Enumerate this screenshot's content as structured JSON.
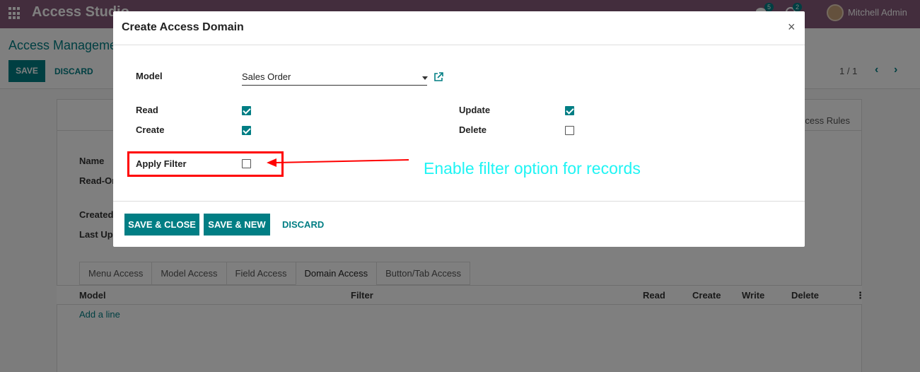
{
  "topbar": {
    "app_title": "Access Studio",
    "chat_count": "5",
    "activity_count": "2",
    "user_name": "Mitchell Admin"
  },
  "control": {
    "breadcrumb": "Access Manageme",
    "save_label": "SAVE",
    "discard_label": "DISCARD",
    "pager": "1 / 1"
  },
  "sheet": {
    "access_rules": "cess Rules",
    "labels": {
      "name": "Name",
      "read_only": "Read-On",
      "created": "Created",
      "last_updated": "Last Upd"
    },
    "tabs": [
      {
        "label": "Menu Access",
        "active": false
      },
      {
        "label": "Model Access",
        "active": false
      },
      {
        "label": "Field Access",
        "active": false
      },
      {
        "label": "Domain Access",
        "active": true
      },
      {
        "label": "Button/Tab Access",
        "active": false
      }
    ],
    "columns": [
      "Model",
      "Filter",
      "Read",
      "Create",
      "Write",
      "Delete"
    ],
    "add_line": "Add a line"
  },
  "modal": {
    "title": "Create Access Domain",
    "close": "×",
    "fields": {
      "model_label": "Model",
      "model_value": "Sales Order",
      "read_label": "Read",
      "read_checked": true,
      "create_label": "Create",
      "create_checked": true,
      "update_label": "Update",
      "update_checked": true,
      "delete_label": "Delete",
      "delete_checked": false,
      "apply_filter_label": "Apply Filter",
      "apply_filter_checked": false
    },
    "annotation": "Enable filter option for records",
    "annotation_color": "#1ff4f4",
    "highlight_color": "#ff0000",
    "footer": {
      "save_close": "SAVE & CLOSE",
      "save_new": "SAVE & NEW",
      "discard": "DISCARD"
    }
  },
  "colors": {
    "primary": "#017e84",
    "topbar": "#875a7b"
  }
}
